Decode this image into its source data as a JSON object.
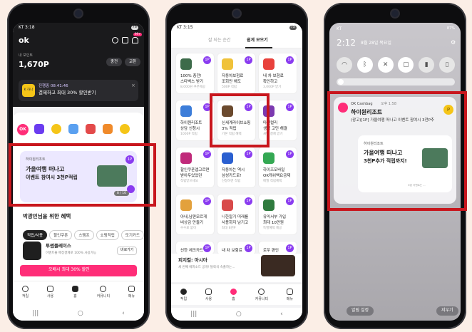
{
  "phone1": {
    "status_time": "KT 3:18",
    "status_battery": "76",
    "logo": "ok",
    "badge": "99+",
    "points_label": "내 포인트",
    "points_value": "1,670P",
    "btn_charge": "충전",
    "btn_exchange": "교환",
    "promo_small": "진행중 08:41:46",
    "promo_main": "결제하고 최대 30% 할인받기",
    "promo_logo": "K 하나",
    "banner_brand": "하이원리조트",
    "banner_line1": "가을여행 떠나고",
    "banner_line2": "이벤트 참여시 3천P적립",
    "banner_counter": "8 / 10",
    "banner_badge": "1P",
    "section_title": "박광민님을 위한 혜택",
    "chips": [
      "적립/사용",
      "할인쿠폰",
      "스탬프",
      "쇼핑적립",
      "모기카드"
    ],
    "store_name": "투썸플레이스",
    "store_desc": "이벤트몰 매장결제로 100% 사용가능",
    "store_button": "바로가기",
    "pink_bar": "오배시 최대 30% 할인",
    "tabs": [
      "적립",
      "사용",
      "홈",
      "커뮤니티",
      "메뉴"
    ]
  },
  "phone2": {
    "status_time": "KT 3:15",
    "status_battery": "75",
    "tab_left": "잘 되는 순간",
    "tab_right": "쉽게 모으기",
    "cards": [
      {
        "l1": "100% 충전!",
        "l2": "스타벅스 받기",
        "l3": "8,000원 쿠폰제공",
        "color": "#3d6b4a"
      },
      {
        "l1": "자동차보험료",
        "l2": "조회만 해도",
        "l3": "500P 적립",
        "color": "#f0c23a"
      },
      {
        "l1": "내 차 보험료",
        "l2": "확인하고",
        "l3": "3,000P 받기",
        "color": "#e8413c"
      },
      {
        "l1": "하이원리조트",
        "l2": "상담 신청시",
        "l3": "1000P 적립",
        "color": "#3c7dd9"
      },
      {
        "l1": "신세계라이브쇼핑",
        "l2": "3% 적립",
        "l3": "기본 적립 혜택",
        "color": "#6b4a2e"
      },
      {
        "l1": "마켓컬리",
        "l2": "생성 고민 해결",
        "l3": "새벽 결제 받기",
        "color": "#7c3ab0"
      },
      {
        "l1": "할인쿠폰앱고르면",
        "l2": "받아두었었던",
        "l3": "적립받으세요",
        "color": "#c02a7a"
      },
      {
        "l1": "자동차는 역시",
        "l2": "삼성카드로!",
        "l3": "신청하면 적립",
        "color": "#2a5fd0"
      },
      {
        "l1": "하이즈모바일",
        "l2": "OK캐쉬백요금제",
        "l3": "매월 적립혜택",
        "color": "#34a853"
      },
      {
        "l1": "아내,남편모르게",
        "l2": "비상금 만들기",
        "l3": "수수료 없이",
        "color": "#e3a13c"
      },
      {
        "l1": "니한알기 미래를",
        "l2": "사용하지 남기고",
        "l3": "최대 8천P",
        "color": "#d84a4a"
      },
      {
        "l1": "유익서부 가입",
        "l2": "최대 10만원",
        "l3": "특별혜택 제공",
        "color": "#2f7b3e"
      },
      {
        "l1": "신한 체크카드",
        "l2": "",
        "l3": "",
        "color": "#2e4fa8"
      },
      {
        "l1": "내 차 보험료",
        "l2": "",
        "l3": "",
        "color": "#e8413c"
      },
      {
        "l1": "로우 편인",
        "l2": "",
        "l3": "",
        "color": "#7a5a3a"
      }
    ],
    "feed_title": "피지컬: 아시아",
    "feed_desc": "새 번째 에피소드 공개! 탈락국 속출하는...",
    "tabs": [
      "적립",
      "사용",
      "홈",
      "커뮤니티",
      "메뉴"
    ]
  },
  "phone3": {
    "carrier": "KT",
    "time": "2:12",
    "date": "8월 28일 목요일",
    "battery": "87%",
    "app_name": "OK Cashbag",
    "app_time": "오후 1:58",
    "notif_title": "하이원리조트",
    "notif_body": "(광고)[1P] 가을여행 떠나고 이벤트 참여시 3천P추",
    "card_brand": "하이원리조트",
    "card_line1": "가을여행 떠나고",
    "card_line2": "3천P추가 적립까지!",
    "card_footer": "※본 이벤트는 ...",
    "badge": "P",
    "btn_settings": "알림 설정",
    "btn_clear": "지우기"
  },
  "colors": {
    "accent_red": "#c8161d",
    "purple": "#8a3cf0",
    "pink": "#ff2d78",
    "dark": "#1a1a1c"
  }
}
